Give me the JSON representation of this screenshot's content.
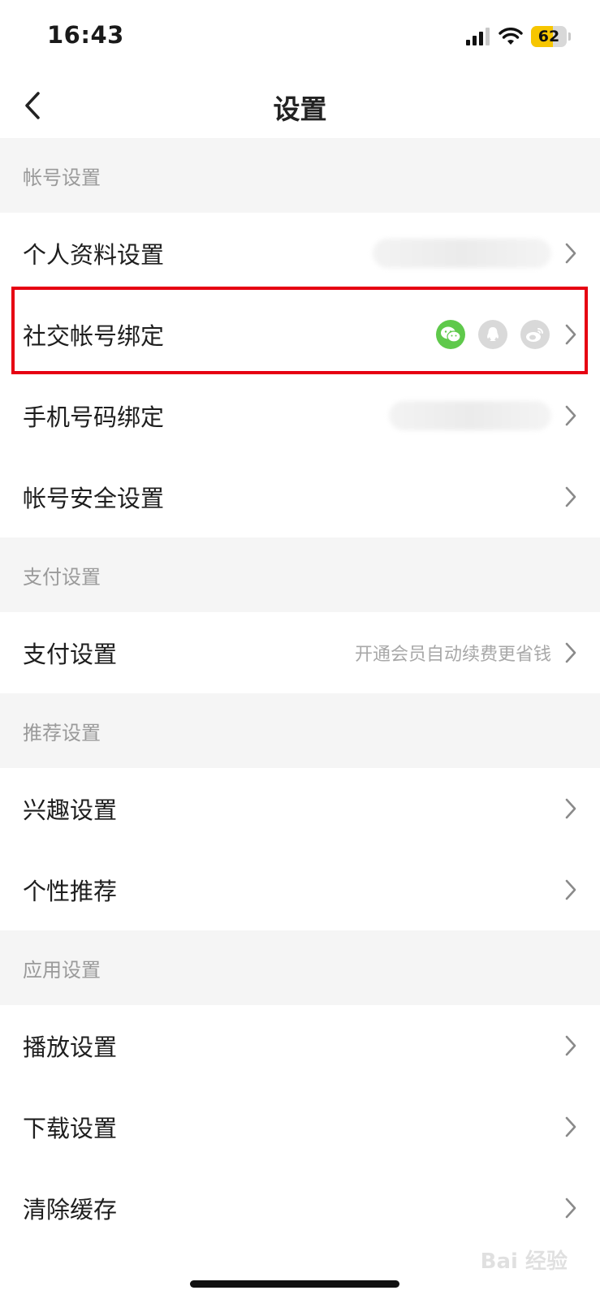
{
  "status_bar": {
    "time": "16:43",
    "battery": "62",
    "battery_level": 0.62
  },
  "nav": {
    "title": "设置"
  },
  "sections": {
    "account": {
      "header": "帐号设置",
      "profile": "个人资料设置",
      "social": "社交帐号绑定",
      "phone": "手机号码绑定",
      "security": "帐号安全设置"
    },
    "payment": {
      "header": "支付设置",
      "pay": "支付设置",
      "pay_value": "开通会员自动续费更省钱"
    },
    "recommend": {
      "header": "推荐设置",
      "interest": "兴趣设置",
      "personal": "个性推荐"
    },
    "app": {
      "header": "应用设置",
      "playback": "播放设置",
      "download": "下载设置",
      "cache": "清除缓存"
    }
  },
  "icons": {
    "wechat": "wechat-icon",
    "qq": "qq-icon",
    "weibo": "weibo-icon"
  },
  "colors": {
    "wechat_green": "#5fc94b",
    "inactive_gray": "#d9d9d9",
    "highlight_red": "#e60012",
    "battery_yellow": "#f7c600"
  },
  "watermark": "Bai 经验"
}
